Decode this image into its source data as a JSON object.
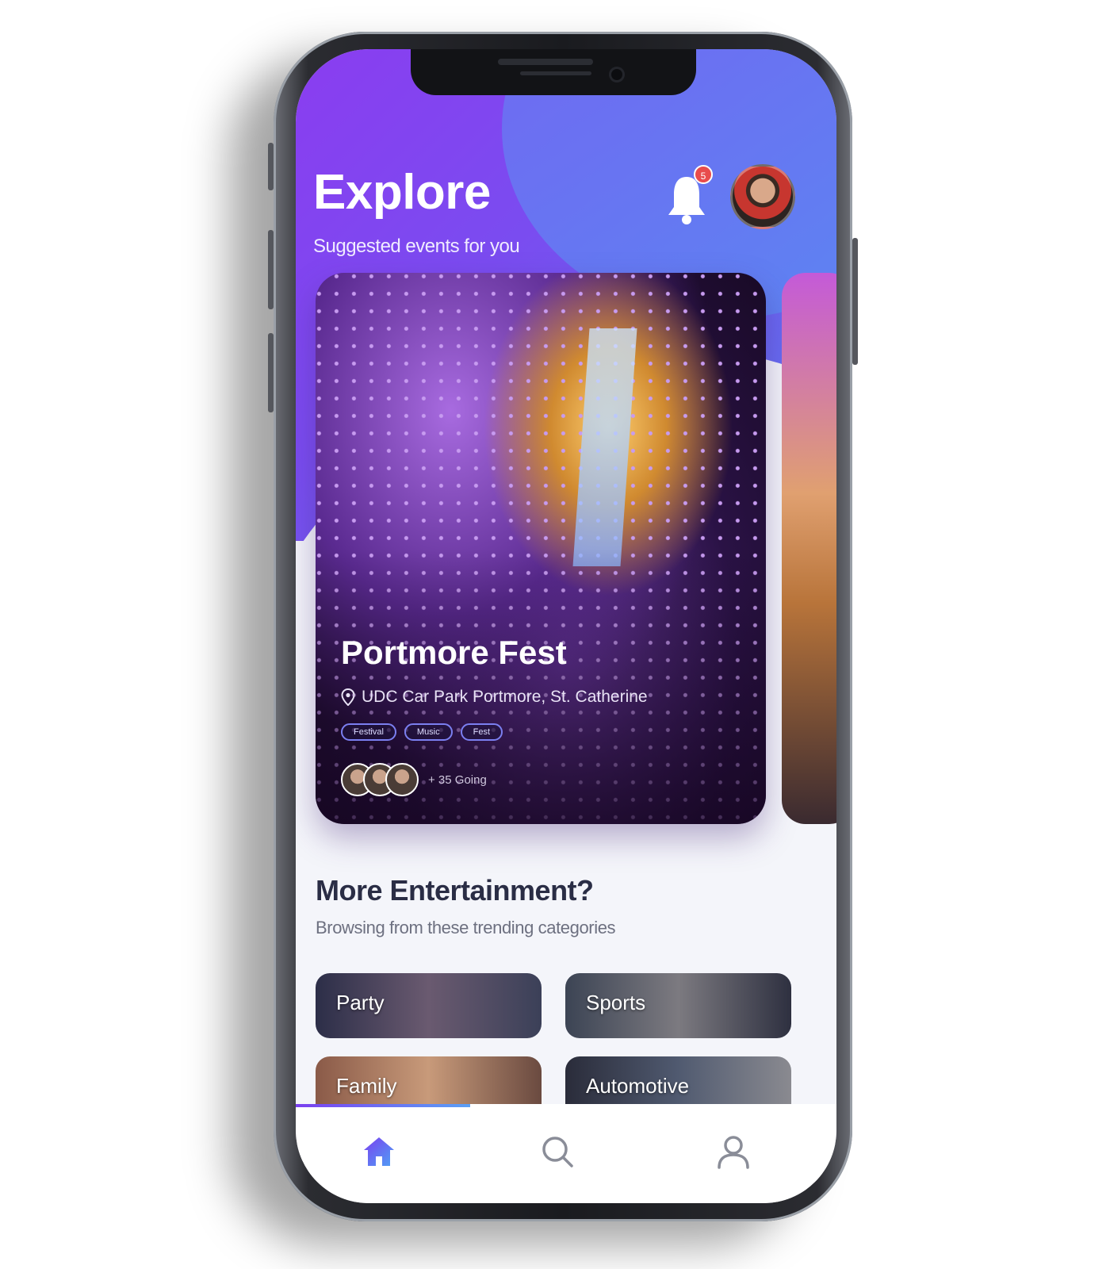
{
  "header": {
    "title": "Explore",
    "subtitle": "Suggested events for you",
    "notification_count": "5"
  },
  "featured_event": {
    "title": "Portmore Fest",
    "location": "UDC Car Park Portmore, St. Catherine",
    "tags": [
      "Festival",
      "Music",
      "Fest"
    ],
    "going": "+ 35 Going"
  },
  "section": {
    "title": "More Entertainment?",
    "subtitle": "Browsing from these trending categories"
  },
  "categories": [
    "Party",
    "Sports",
    "Family",
    "Automotive"
  ],
  "nav": {
    "items": [
      "home-icon",
      "search-icon",
      "profile-icon"
    ],
    "active": "home-icon"
  },
  "colors": {
    "accent_purple": "#8a3df0",
    "accent_blue": "#5aa0f5",
    "active_nav": "#4f7cf0",
    "badge_red": "#e84c4c"
  }
}
